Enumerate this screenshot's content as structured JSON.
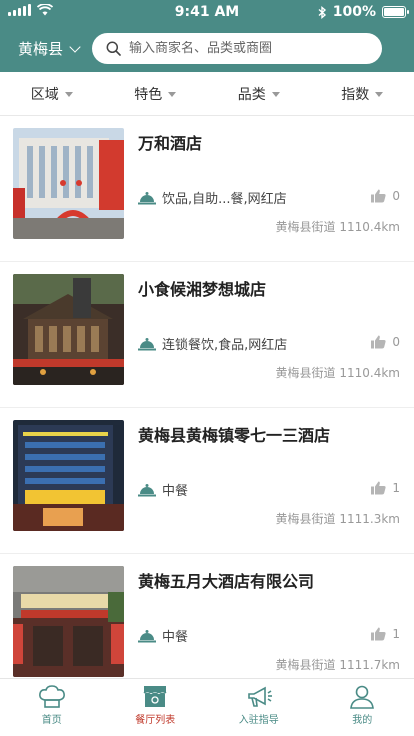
{
  "status_bar": {
    "time": "9:41 AM",
    "battery": "100%"
  },
  "header": {
    "city": "黄梅县",
    "search_placeholder": "输入商家名、品类或商圈"
  },
  "filters": [
    {
      "label": "区域"
    },
    {
      "label": "特色"
    },
    {
      "label": "品类"
    },
    {
      "label": "指数"
    }
  ],
  "restaurants": [
    {
      "name": "万和酒店",
      "category": "饮品,自助...餐,网红店",
      "likes": "0",
      "location": "黄梅县街道 1110.4km"
    },
    {
      "name": "小食候湘梦想城店",
      "category": "连锁餐饮,食品,网红店",
      "likes": "0",
      "location": "黄梅县街道 1110.4km"
    },
    {
      "name": "黄梅县黄梅镇零七一三酒店",
      "category": "中餐",
      "likes": "1",
      "location": "黄梅县街道 1111.3km"
    },
    {
      "name": "黄梅五月大酒店有限公司",
      "category": "中餐",
      "likes": "1",
      "location": "黄梅县街道 1111.7km"
    }
  ],
  "tabs": [
    {
      "label": "首页",
      "icon": "chef-hat-icon"
    },
    {
      "label": "餐厅列表",
      "icon": "restaurant-icon"
    },
    {
      "label": "入驻指导",
      "icon": "megaphone-icon"
    },
    {
      "label": "我的",
      "icon": "user-icon"
    }
  ],
  "colors": {
    "brand": "#4a8b86",
    "active_tab": "#c0392b"
  }
}
